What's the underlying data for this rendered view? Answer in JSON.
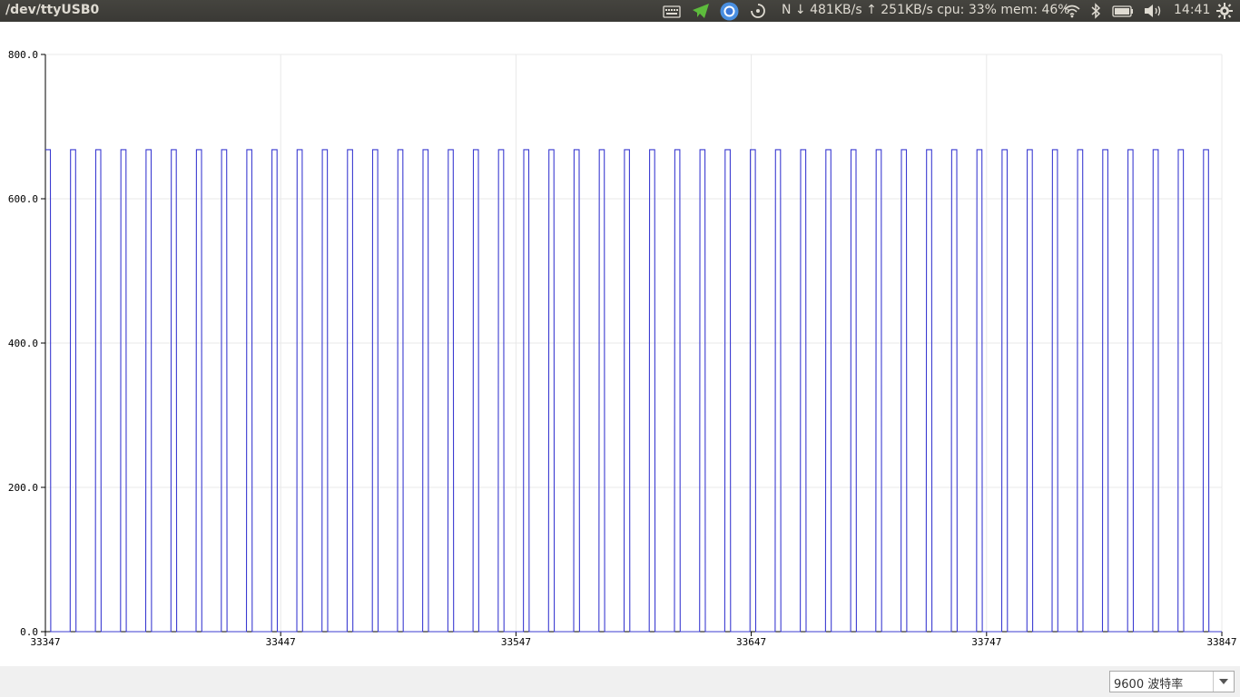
{
  "topbar": {
    "window_title": "/dev/ttyUSB0",
    "net_status": "N ↓ 481KB/s ↑ 251KB/s cpu: 33% mem: 46%",
    "clock": "14:41",
    "icons": [
      "keyboard-icon",
      "telegram-icon",
      "chrome-icon",
      "sync-icon",
      "wifi-icon",
      "bluetooth-icon",
      "battery-icon",
      "volume-icon",
      "gear-icon"
    ]
  },
  "chart_data": {
    "type": "line",
    "title": "",
    "xlabel": "",
    "ylabel": "",
    "xlim": [
      33347,
      33847
    ],
    "ylim": [
      0,
      800
    ],
    "x_ticks": [
      "33347",
      "33447",
      "33547",
      "33647",
      "33747",
      "33847"
    ],
    "y_ticks": [
      "0.0",
      "200.0",
      "400.0",
      "600.0",
      "800.0"
    ],
    "grid": true,
    "series": [
      {
        "color": "#3b3bd1",
        "pattern": "square pulse train",
        "low": 0,
        "high": 668,
        "period": 10.7,
        "duty_cycle": 0.2
      }
    ]
  },
  "footer": {
    "baud_rate": "9600 波特率"
  }
}
